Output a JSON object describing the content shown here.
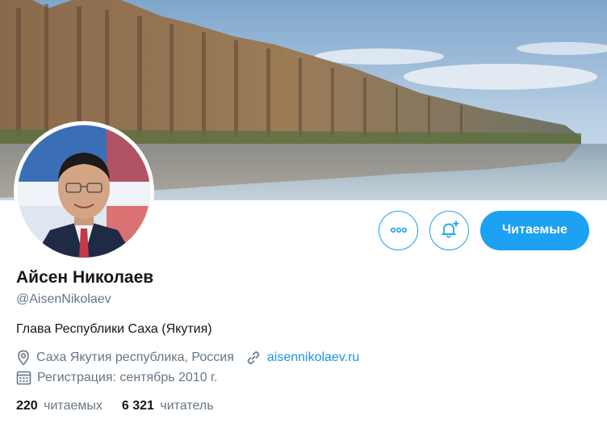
{
  "profile": {
    "name": "Айсен Николаев",
    "handle": "@AisenNikolaev",
    "bio": "Глава Республики Саха (Якутия)",
    "location": "Саха Якутия республика, Россия",
    "website": "aisennikolaev.ru",
    "joined": "Регистрация: сентябрь 2010 г."
  },
  "actions": {
    "more_icon": "more-horizontal-icon",
    "notify_icon": "bell-plus-icon",
    "follow_label": "Читаемые"
  },
  "stats": {
    "following_count": "220",
    "following_label": "читаемых",
    "followers_count": "6 321",
    "followers_label": "читатель"
  },
  "colors": {
    "accent": "#1da1f2",
    "link": "#1b95e0",
    "secondary_text": "#657786",
    "primary_text": "#14171a"
  }
}
